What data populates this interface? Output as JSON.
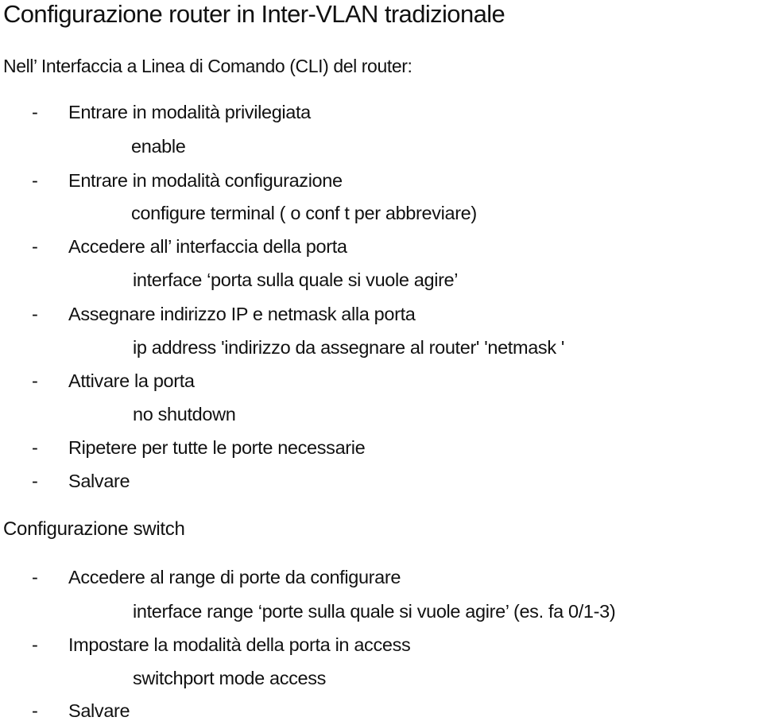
{
  "document": {
    "title": "Configurazione router in Inter-VLAN tradizionale",
    "router_section": {
      "intro": "Nell’ Interfaccia a Linea di Comando (CLI) del router:",
      "steps": [
        {
          "bullet": "-",
          "text": "Entrare in modalità privilegiata",
          "command": "enable"
        },
        {
          "bullet": "-",
          "text": "Entrare in modalità configurazione",
          "command": "configure terminal ( o conf t per abbreviare)"
        },
        {
          "bullet": "-",
          "text": "Accedere all’ interfaccia della porta",
          "command": "interface ‘porta sulla quale si vuole agire’"
        },
        {
          "bullet": "-",
          "text": "Assegnare indirizzo IP e netmask alla porta",
          "command": "ip address 'indirizzo da assegnare al router'  'netmask '"
        },
        {
          "bullet": "-",
          "text": "Attivare la porta",
          "command": "no shutdown"
        },
        {
          "bullet": "-",
          "text": "Ripetere per tutte le porte necessarie"
        },
        {
          "bullet": "-",
          "text": "Salvare"
        }
      ]
    },
    "switch_section": {
      "heading": "Configurazione switch",
      "steps": [
        {
          "bullet": "-",
          "text": "Accedere al range di porte da configurare",
          "command": "interface range ‘porte sulla quale si vuole agire’  (es. fa 0/1-3)"
        },
        {
          "bullet": "-",
          "text": "Impostare la modalità della porta in access",
          "command": "switchport mode access"
        },
        {
          "bullet": "-",
          "text": "Salvare"
        }
      ]
    }
  }
}
